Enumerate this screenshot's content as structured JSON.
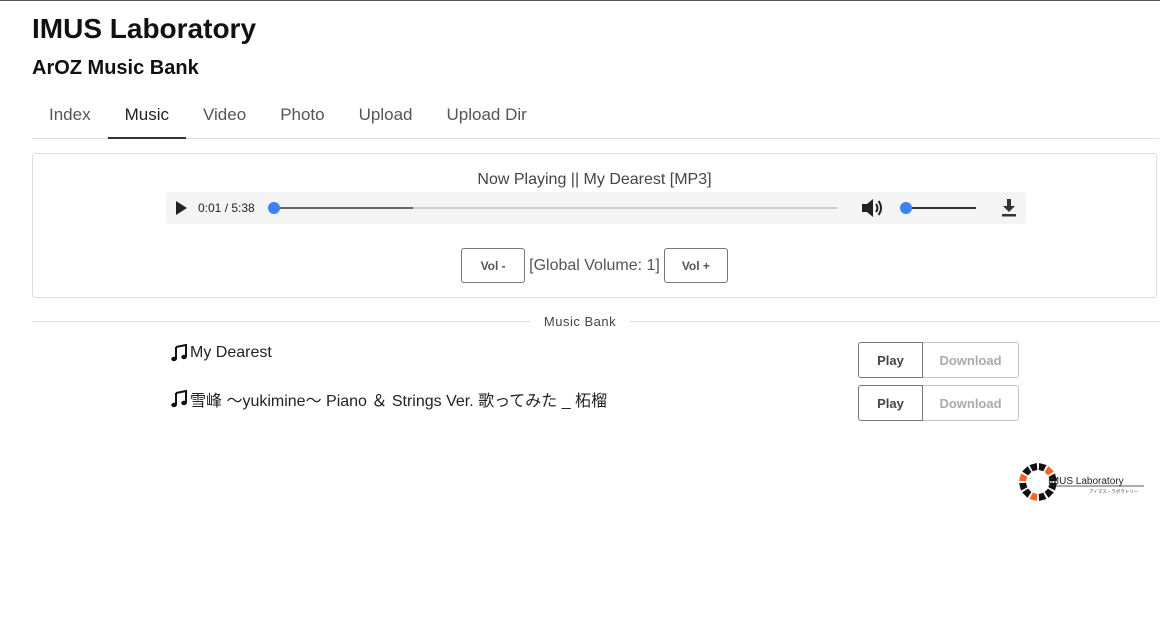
{
  "header": {
    "title": "IMUS Laboratory",
    "subtitle": "ArOZ Music Bank"
  },
  "tabs": [
    {
      "label": "Index",
      "active": false
    },
    {
      "label": "Music",
      "active": true
    },
    {
      "label": "Video",
      "active": false
    },
    {
      "label": "Photo",
      "active": false
    },
    {
      "label": "Upload",
      "active": false
    },
    {
      "label": "Upload Dir",
      "active": false
    }
  ],
  "player": {
    "now_playing": "Now Playing || My Dearest [MP3]",
    "time": "0:01 / 5:38",
    "position_fraction": 0.003,
    "buffered_fraction": 0.25,
    "volume_fraction": 0.0,
    "vol_down_label": "Vol -",
    "vol_up_label": "Vol +",
    "global_volume_text": "[Global Volume: 1]",
    "accent_color": "#3b82f6"
  },
  "section": {
    "label": "Music Bank"
  },
  "tracks": [
    {
      "name": "My Dearest",
      "play_label": "Play",
      "download_label": "Download"
    },
    {
      "name": "雪峰 ～yukimine～ Piano ＆ Strings Ver. 歌ってみた _ 柘榴",
      "play_label": "Play",
      "download_label": "Download"
    }
  ],
  "logo": {
    "text": "IMUS Laboratory",
    "subtext": "アイマス・ラボラトリー",
    "colors": [
      "#f26522",
      "#111111"
    ]
  }
}
